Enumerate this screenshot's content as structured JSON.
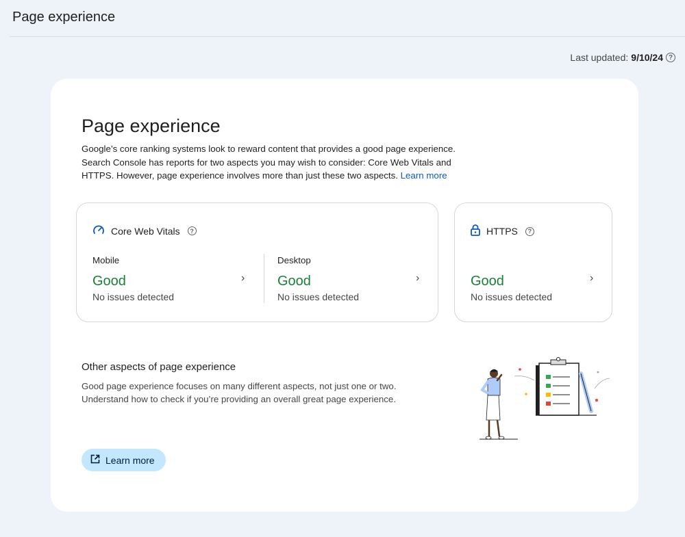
{
  "header": {
    "title": "Page experience"
  },
  "updated": {
    "label": "Last updated:",
    "date": "9/10/24"
  },
  "main": {
    "title": "Page experience",
    "intro": "Google’s core ranking systems look to reward content that provides a good page experience. Search Console has reports for two aspects you may wish to consider: Core Web Vitals and HTTPS. However, page experience involves more than just these two aspects.",
    "intro_link": "Learn more"
  },
  "cwv": {
    "title": "Core Web Vitals",
    "mobile": {
      "label": "Mobile",
      "status": "Good",
      "detail": "No issues detected"
    },
    "desktop": {
      "label": "Desktop",
      "status": "Good",
      "detail": "No issues detected"
    }
  },
  "https": {
    "title": "HTTPS",
    "status": "Good",
    "detail": "No issues detected"
  },
  "other": {
    "title": "Other aspects of page experience",
    "description": "Good page experience focuses on many different aspects, not just one or two. Understand how to check if you’re providing an overall great page experience.",
    "button": "Learn more"
  },
  "icons": {
    "help": "help-circle-icon",
    "cwv": "speedometer-icon",
    "https": "lock-icon",
    "chevron": "chevron-right-icon",
    "open": "open-in-new-icon"
  },
  "colors": {
    "good": "#188038",
    "link": "#0b57d0",
    "button_bg": "#c2e7ff",
    "page_bg": "#eef2f9"
  }
}
